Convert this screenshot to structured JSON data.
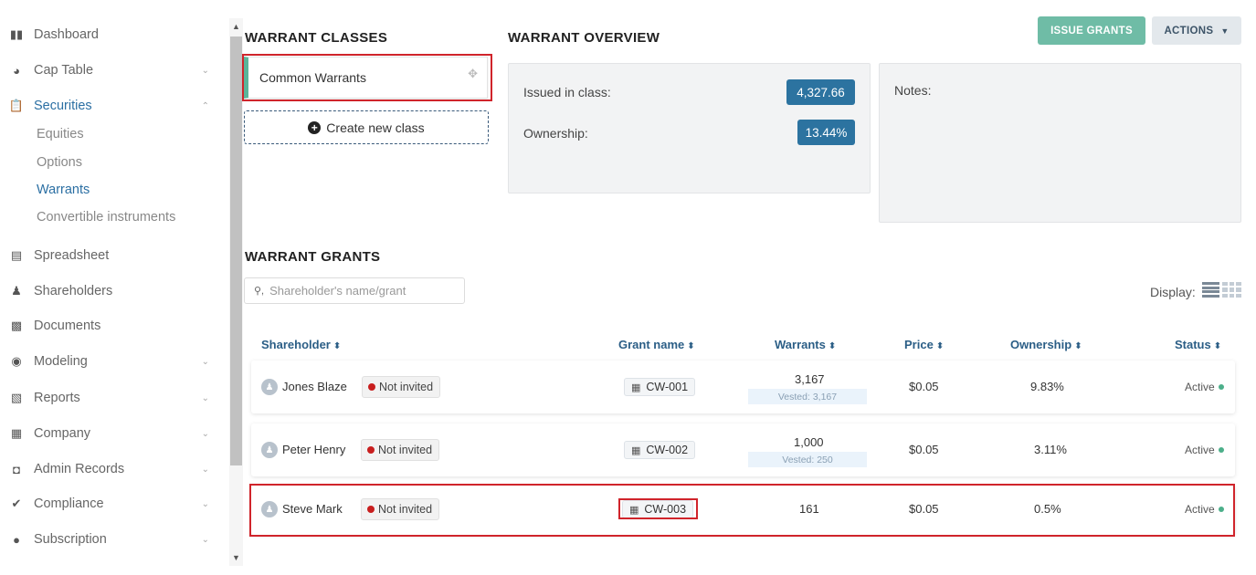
{
  "sidebar": {
    "items": [
      {
        "label": "Dashboard"
      },
      {
        "label": "Cap Table"
      },
      {
        "label": "Securities"
      },
      {
        "label": "Spreadsheet"
      },
      {
        "label": "Shareholders"
      },
      {
        "label": "Documents"
      },
      {
        "label": "Modeling"
      },
      {
        "label": "Reports"
      },
      {
        "label": "Company"
      },
      {
        "label": "Admin Records"
      },
      {
        "label": "Compliance"
      },
      {
        "label": "Subscription"
      }
    ],
    "securities_sub": [
      {
        "label": "Equities"
      },
      {
        "label": "Options"
      },
      {
        "label": "Warrants"
      },
      {
        "label": "Convertible instruments"
      }
    ]
  },
  "classes": {
    "title": "WARRANT CLASSES",
    "items": [
      {
        "label": "Common Warrants"
      }
    ],
    "create_label": "Create new class"
  },
  "overview": {
    "title": "WARRANT OVERVIEW",
    "issued_label": "Issued in class:",
    "issued_value": "4,327.66",
    "ownership_label": "Ownership:",
    "ownership_value": "13.44%",
    "notes_label": "Notes:"
  },
  "toolbar": {
    "issue_label": "ISSUE GRANTS",
    "actions_label": "ACTIONS"
  },
  "grants": {
    "title": "WARRANT GRANTS",
    "search_placeholder": "Shareholder's name/grant",
    "display_label": "Display:",
    "columns": [
      "Shareholder",
      "Grant name",
      "Warrants",
      "Price",
      "Ownership",
      "Status"
    ],
    "rows": [
      {
        "shareholder": "Jones Blaze",
        "invite": "Not invited",
        "grant": "CW-001",
        "warrants": "3,167",
        "vested": "Vested: 3,167",
        "price": "$0.05",
        "ownership": "9.83%",
        "status": "Active"
      },
      {
        "shareholder": "Peter Henry",
        "invite": "Not invited",
        "grant": "CW-002",
        "warrants": "1,000",
        "vested": "Vested: 250",
        "price": "$0.05",
        "ownership": "3.11%",
        "status": "Active"
      },
      {
        "shareholder": "Steve Mark",
        "invite": "Not invited",
        "grant": "CW-003",
        "warrants": "161",
        "vested": "",
        "price": "$0.05",
        "ownership": "0.5%",
        "status": "Active"
      }
    ]
  },
  "colors": {
    "accent": "#2c73a0",
    "issue_button": "#6fbca6",
    "active_nav": "#2b6fa3",
    "highlight": "#d0242b",
    "not_invited_dot": "#c81e1e",
    "status_dot": "#4caf8a"
  }
}
